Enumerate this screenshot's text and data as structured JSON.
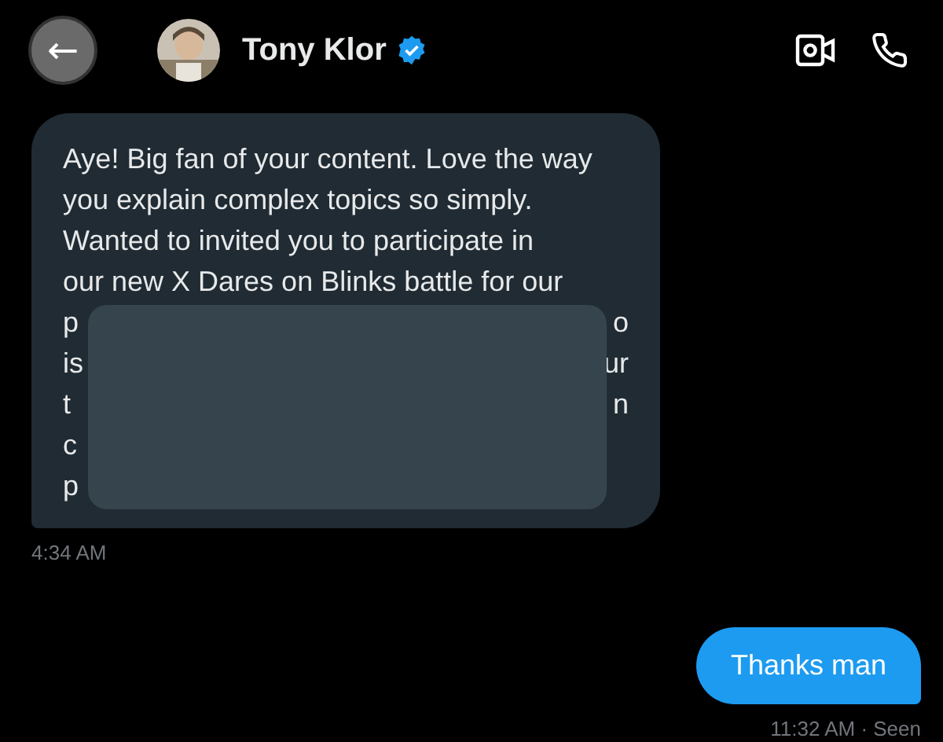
{
  "header": {
    "back": "←",
    "name": "Tony Klor",
    "verified": true
  },
  "messages": [
    {
      "kind": "incoming",
      "lines": [
        "Aye! Big fan of your content. Love the way",
        "you explain complex topics so simply.",
        "Wanted to invited you to participate in",
        "our new X Dares on Blinks battle for our"
      ],
      "redacted_lines": [
        {
          "left": "p",
          "right": "o"
        },
        {
          "left": "is",
          "right": "ur"
        },
        {
          "left": "t",
          "right": "n"
        },
        {
          "left": "c"
        },
        {
          "left": "p"
        }
      ],
      "time": "4:34 AM"
    },
    {
      "kind": "outgoing",
      "lines": [
        "Thanks man"
      ],
      "time": "11:32 AM · Seen"
    }
  ]
}
